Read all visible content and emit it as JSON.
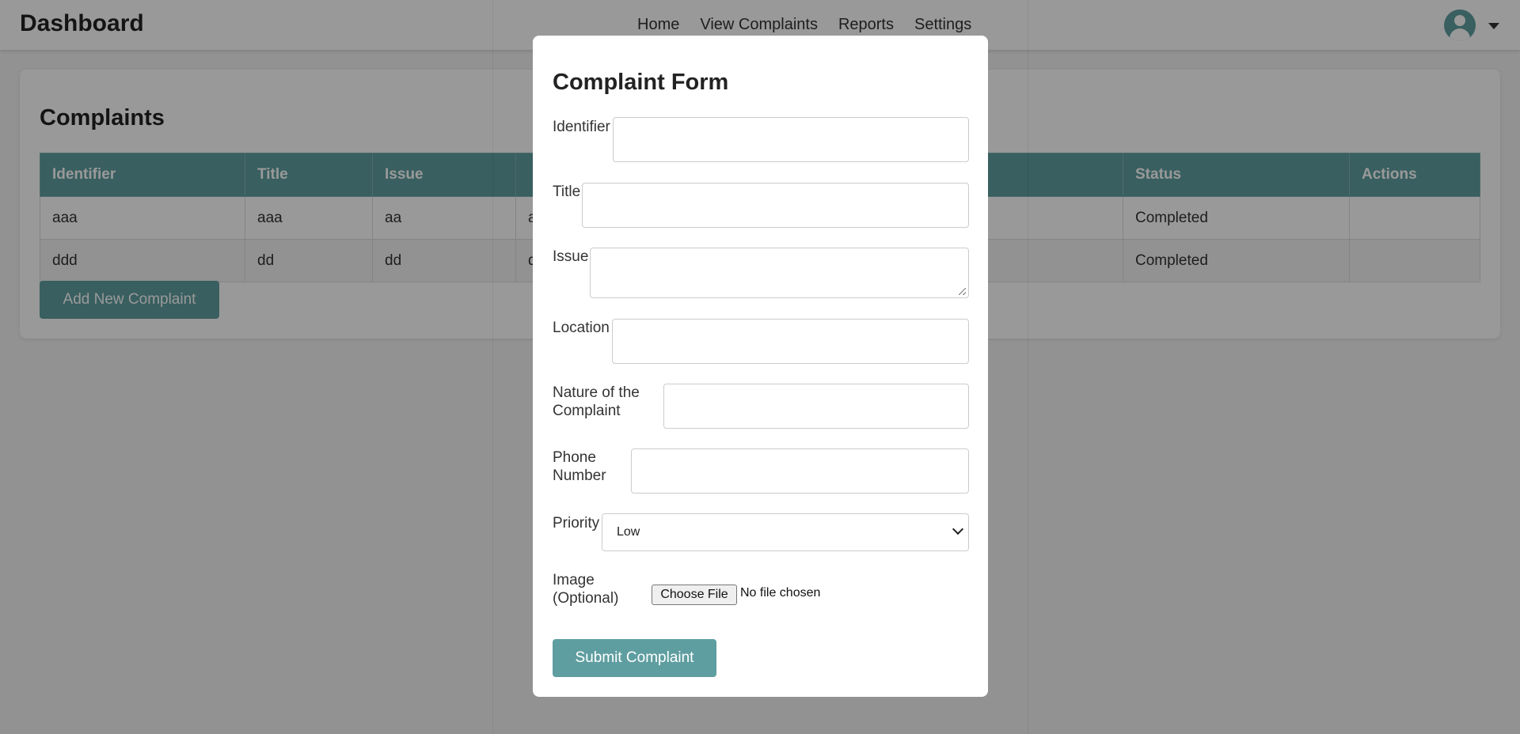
{
  "header": {
    "brand": "Dashboard",
    "nav": [
      "Home",
      "View Complaints",
      "Reports",
      "Settings"
    ]
  },
  "complaints": {
    "title": "Complaints",
    "columns": [
      "Identifier",
      "Title",
      "Issue",
      "",
      "",
      "Status",
      "Actions"
    ],
    "rows": [
      [
        "aaa",
        "aaa",
        "aa",
        "a",
        "",
        "Completed",
        ""
      ],
      [
        "ddd",
        "dd",
        "dd",
        "d",
        "",
        "Completed",
        ""
      ]
    ],
    "add_button": "Add New Complaint"
  },
  "modal": {
    "title": "Complaint Form",
    "labels": {
      "identifier": "Identifier",
      "title": "Title",
      "issue": "Issue",
      "location": "Location",
      "nature": "Nature of the Complaint",
      "phone": "Phone Number",
      "priority": "Priority",
      "image": "Image (Optional)"
    },
    "priority_value": "Low",
    "file_button": "Choose File",
    "file_status": "No file chosen",
    "submit": "Submit Complaint"
  },
  "colors": {
    "accent": "#5f9ea0",
    "overlay": "rgba(0,0,0,0.4)"
  }
}
